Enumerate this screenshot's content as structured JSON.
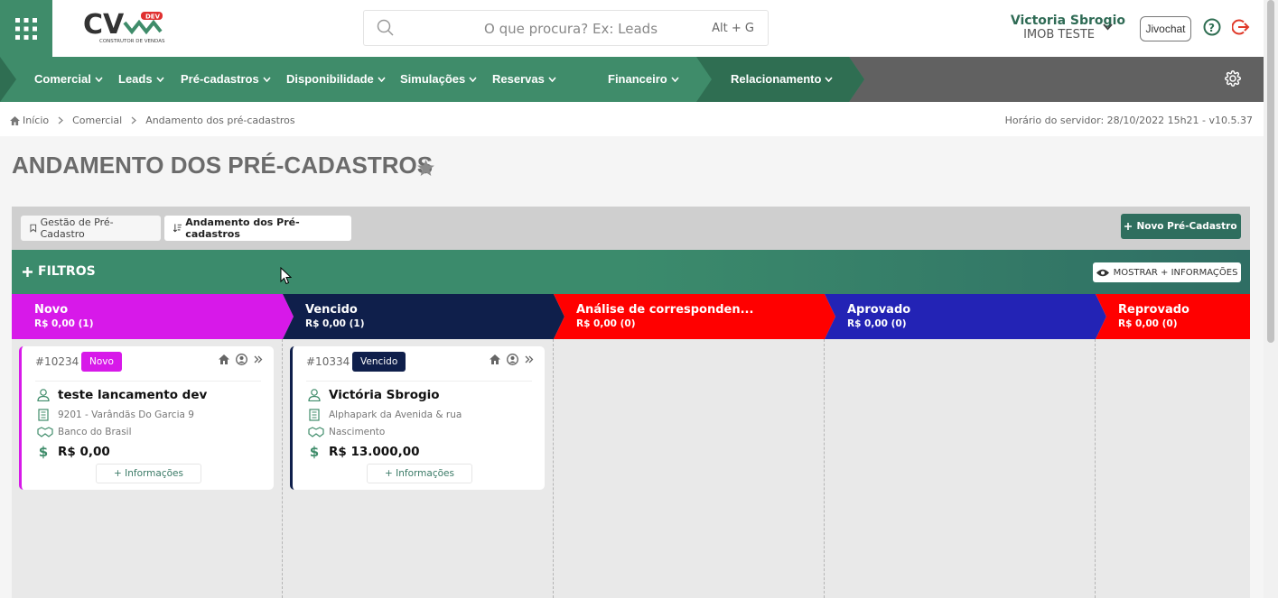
{
  "header": {
    "logo_text": "CV",
    "logo_badge": "DEV",
    "logo_sub": "CONSTRUTOR DE VENDAS",
    "search_placeholder": "O que procura? Ex: Leads",
    "search_shortcut": "Alt + G",
    "user_name": "Victoria Sbrogio",
    "user_company": "IMOB TESTE",
    "chat_label": "Jivochat"
  },
  "nav": {
    "items": [
      {
        "label": "Comercial"
      },
      {
        "label": "Leads"
      },
      {
        "label": "Pré-cadastros"
      },
      {
        "label": "Disponibilidade"
      },
      {
        "label": "Simulações"
      },
      {
        "label": "Reservas"
      },
      {
        "label": "Financeiro"
      },
      {
        "label": "Relacionamento"
      }
    ]
  },
  "breadcrumb": {
    "items": [
      "Início",
      "Comercial",
      "Andamento dos pré-cadastros"
    ],
    "server_info": "Horário do servidor: 28/10/2022 15h21 - v10.5.37"
  },
  "page": {
    "title": "ANDAMENTO DOS PRÉ-CADASTROS",
    "tabs": [
      "Gestão de Pré-Cadastro",
      "Andamento dos Pré-cadastros"
    ],
    "new_button": "Novo Pré-Cadastro",
    "filters_label": "FILTROS",
    "more_info_button": "MOSTRAR + INFORMAÇÕES"
  },
  "columns": [
    {
      "title": "Novo",
      "summary": "R$ 0,00 (1)",
      "color": "#d719e9"
    },
    {
      "title": "Vencido",
      "summary": "R$ 0,00 (1)",
      "color": "#0f1f4b"
    },
    {
      "title": "Análise de corresponden...",
      "summary": "R$ 0,00 (0)",
      "color": "#ff0000"
    },
    {
      "title": "Aprovado",
      "summary": "R$ 0,00 (0)",
      "color": "#2323b5"
    },
    {
      "title": "Reprovado",
      "summary": "R$ 0,00 (0)",
      "color": "#ff0000"
    }
  ],
  "cards": [
    {
      "id": "#10234",
      "badge": "Novo",
      "color": "#d719e9",
      "name": "teste lancamento dev",
      "property": "9201 - Varândãs Do Garcia 9",
      "bank": "Banco do Brasil",
      "value": "R$ 0,00",
      "more": "+ Informações"
    },
    {
      "id": "#10334",
      "badge": "Vencido",
      "color": "#0f1f4b",
      "name": "Victória Sbrogio",
      "property": "Alphapark da Avenida & rua",
      "bank": "Nascimento",
      "value": "R$ 13.000,00",
      "more": "+ Informações"
    }
  ]
}
